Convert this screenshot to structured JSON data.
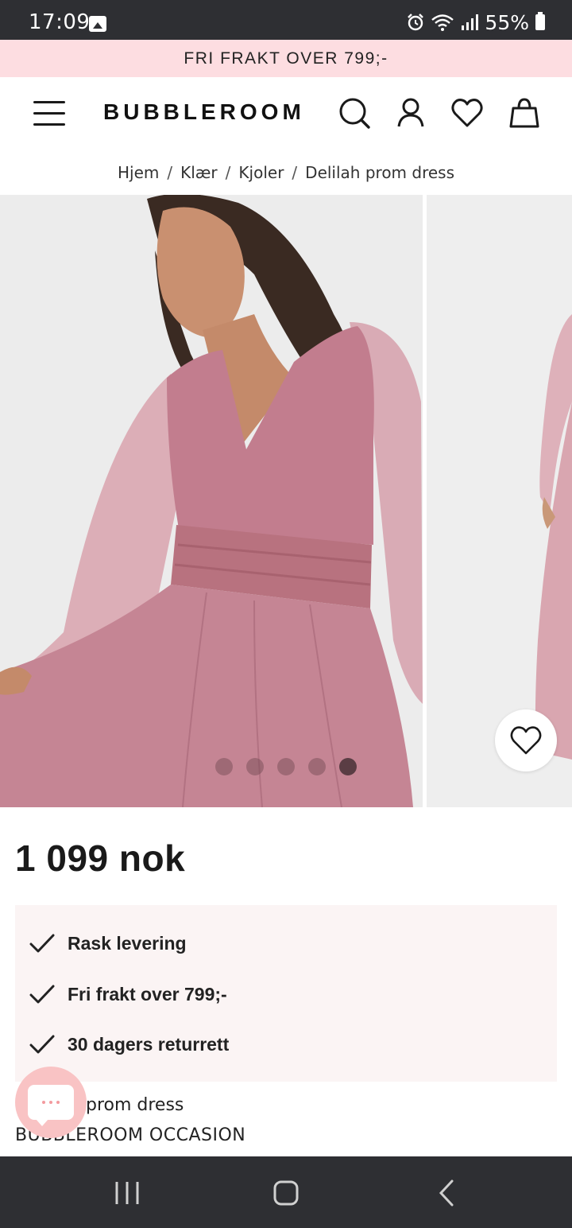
{
  "status_bar": {
    "time": "17:09",
    "battery": "55%",
    "icons": [
      "gallery-icon",
      "alarm-icon",
      "wifi-icon",
      "signal-icon",
      "battery-icon"
    ]
  },
  "promo": {
    "text": "FRI FRAKT OVER 799;-",
    "background": "#fddde1"
  },
  "header": {
    "logo": "BUBBLEROOM",
    "icons": [
      "menu-icon",
      "search-icon",
      "account-icon",
      "wishlist-icon",
      "bag-icon"
    ]
  },
  "breadcrumb": {
    "items": [
      "Hjem",
      "Klær",
      "Kjoler",
      "Delilah prom dress"
    ],
    "separator": "/"
  },
  "gallery": {
    "image_count": 5,
    "active_index": 4,
    "dress_color": "#c98a98"
  },
  "product": {
    "price": "1 099 nok",
    "name": "Delilah prom dress",
    "name_visible": "prom dress",
    "brand": "BUBBLEROOM OCCASION"
  },
  "usps": [
    {
      "icon": "check-icon",
      "text": "Rask levering"
    },
    {
      "icon": "check-icon",
      "text": "Fri frakt over 799;-"
    },
    {
      "icon": "check-icon",
      "text": "30 dagers returrett"
    }
  ],
  "chat": {
    "icon": "chat-icon",
    "color": "#f9c3c4"
  },
  "nav_bar": {
    "buttons": [
      "recents-icon",
      "home-icon",
      "back-icon"
    ]
  }
}
